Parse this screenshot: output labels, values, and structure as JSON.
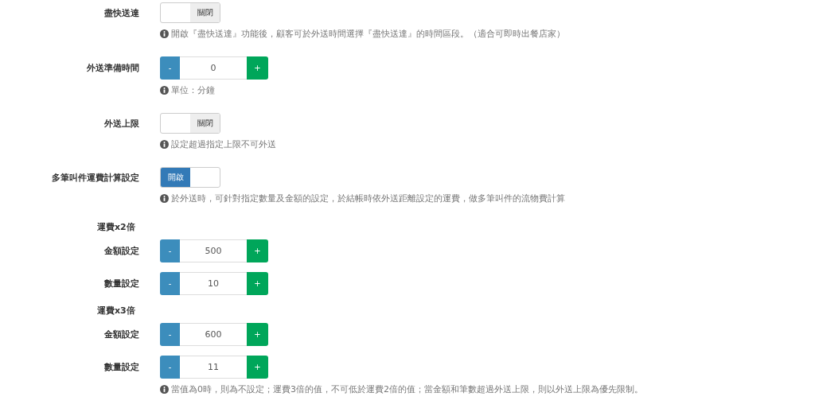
{
  "settings": [
    {
      "kind": "toggle",
      "label": "盡快送達",
      "on": false,
      "state_text": "關閉",
      "help": "開啟『盡快送達』功能後，顧客可於外送時間選擇『盡快送達』的時間區段。（適合可即時出餐店家）"
    },
    {
      "kind": "stepper",
      "label": "外送準備時間",
      "minus": "-",
      "value": "0",
      "plus": "+",
      "help": "單位：分鐘"
    },
    {
      "kind": "toggle",
      "label": "外送上限",
      "on": false,
      "state_text": "關閉",
      "help": "設定超過指定上限不可外送"
    },
    {
      "kind": "toggle",
      "label": "多筆叫件運費計算設定",
      "on": true,
      "state_text": "開啟",
      "help": "於外送時，可針對指定數量及金額的設定，於結帳時依外送距離設定的運費，做多筆叫件的流物費計算"
    },
    {
      "kind": "heading",
      "label": "運費x2倍"
    },
    {
      "kind": "stepper",
      "label": "金額設定",
      "minus": "-",
      "value": "500",
      "plus": "+"
    },
    {
      "kind": "stepper",
      "label": "數量設定",
      "minus": "-",
      "value": "10",
      "plus": "+"
    },
    {
      "kind": "heading",
      "label": "運費x3倍"
    },
    {
      "kind": "stepper",
      "label": "金額設定",
      "minus": "-",
      "value": "600",
      "plus": "+"
    },
    {
      "kind": "stepper",
      "label": "數量設定",
      "minus": "-",
      "value": "11",
      "plus": "+",
      "help": "當值為0時，則為不設定；運費3倍的值，不可低於運費2倍的值；當金額和筆數超過外送上限，則以外送上限為優先限制。"
    }
  ]
}
